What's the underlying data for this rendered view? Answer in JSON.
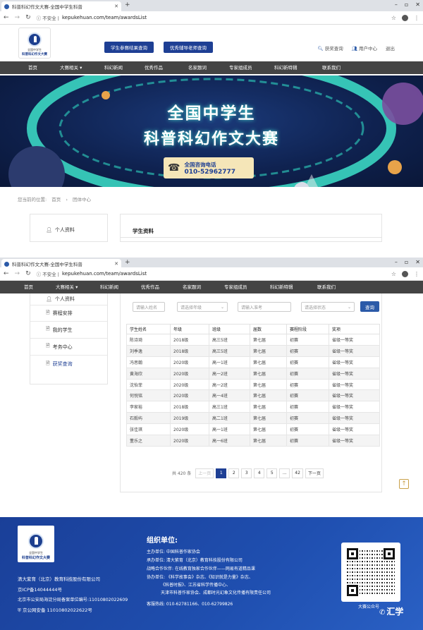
{
  "browser": {
    "tab_title": "科普科幻作文大赛-全国中学生科普",
    "secure_label": "不安全",
    "url": "kepukehuan.com/team/awardsList"
  },
  "header": {
    "logo_line1": "全国中学生",
    "logo_line2": "科普科幻作文大赛",
    "btn_student_results": "学生参赛结果查询",
    "btn_teacher_query": "优秀辅导老师查询",
    "link_awards": "获奖查询",
    "link_user_center": "用户中心",
    "link_logout": "退出"
  },
  "nav": {
    "home": "首页",
    "contest": "大赛相关",
    "news": "科幻新闻",
    "works": "优秀作品",
    "experts": "名家题词",
    "committee": "专家组成员",
    "special": "科幻新特辑",
    "contact": "联系我们"
  },
  "banner": {
    "title1": "全国中学生",
    "title2": "科普科幻作文大赛",
    "phone_label": "全国咨询电话",
    "phone_number": "010-52962777"
  },
  "breadcrumb": {
    "prefix": "您当前的位置:",
    "home": "首页",
    "current": "团体中心"
  },
  "sidebar": {
    "items": [
      {
        "label": "个人资料"
      },
      {
        "label": "赛程安排"
      },
      {
        "label": "我的学生"
      },
      {
        "label": "考务中心"
      },
      {
        "label": "获奖查询"
      }
    ]
  },
  "main": {
    "section_title": "学生资料",
    "filters": {
      "name_placeholder": "请输入姓名",
      "grade_select": "请选择年级",
      "exam_placeholder": "请输入准考",
      "status_select": "请选择状态",
      "query_button": "查询"
    },
    "table": {
      "headers": [
        "学生姓名",
        "年级",
        "班级",
        "届数",
        "赛程阶段",
        "奖项"
      ],
      "rows": [
        [
          "陈诗琦",
          "2018级",
          "高三5班",
          "第七届",
          "初赛",
          "省级一等奖"
        ],
        [
          "刘季逸",
          "2018级",
          "高三5班",
          "第七届",
          "初赛",
          "省级一等奖"
        ],
        [
          "冯思翰",
          "2020级",
          "高一1班",
          "第七届",
          "初赛",
          "省级一等奖"
        ],
        [
          "黄海欣",
          "2020级",
          "高一2班",
          "第七届",
          "初赛",
          "省级一等奖"
        ],
        [
          "沈怡菲",
          "2020级",
          "高一2班",
          "第七届",
          "初赛",
          "省级一等奖"
        ],
        [
          "何悦铭",
          "2020级",
          "高一4班",
          "第七届",
          "初赛",
          "省级一等奖"
        ],
        [
          "李家裕",
          "2018级",
          "高三1班",
          "第七届",
          "初赛",
          "省级一等奖"
        ],
        [
          "石毅屿",
          "2019级",
          "高二1班",
          "第七届",
          "初赛",
          "省级一等奖"
        ],
        [
          "张佳琪",
          "2020级",
          "高一1班",
          "第七届",
          "初赛",
          "省级一等奖"
        ],
        [
          "董乐之",
          "2020级",
          "高一6班",
          "第七届",
          "初赛",
          "省级一等奖"
        ]
      ]
    },
    "pagination": {
      "total": "共 420 条",
      "prev": "上一页",
      "pages": [
        "1",
        "2",
        "3",
        "4",
        "5",
        "...",
        "42"
      ],
      "next": "下一页"
    }
  },
  "footer": {
    "company": "清大紫育（北京）教育科技股份有限公司",
    "icp": "京ICP备14044444号",
    "police": "北京市公安局海淀分局备案单位编号:11010802022609",
    "gongan": "京公网安备 11010802022622号",
    "org_title": "组织单位:",
    "org_lines": [
      "主办单位: 中国科普作家协会",
      "承办单位: 清大紫育（北京）教育科技股份有限公司",
      "战略合作伙伴: 在线教育独家合作伙伴——网易有道精品课",
      "协办单位: 《科学故事会》杂志、《知识就是力量》杂志、",
      "《科普时报》、江苏省科学传播中心、",
      "天津市科普作家协会、成都时光幻象文化传播有限责任公司",
      "客服热线: 010-62781166、010-62799826"
    ],
    "qr_label": "大赛公众号",
    "watermark": "汇学"
  },
  "colors": {
    "primary": "#1e3f94",
    "navbar": "#444444",
    "footer": "#1f4fb0"
  }
}
